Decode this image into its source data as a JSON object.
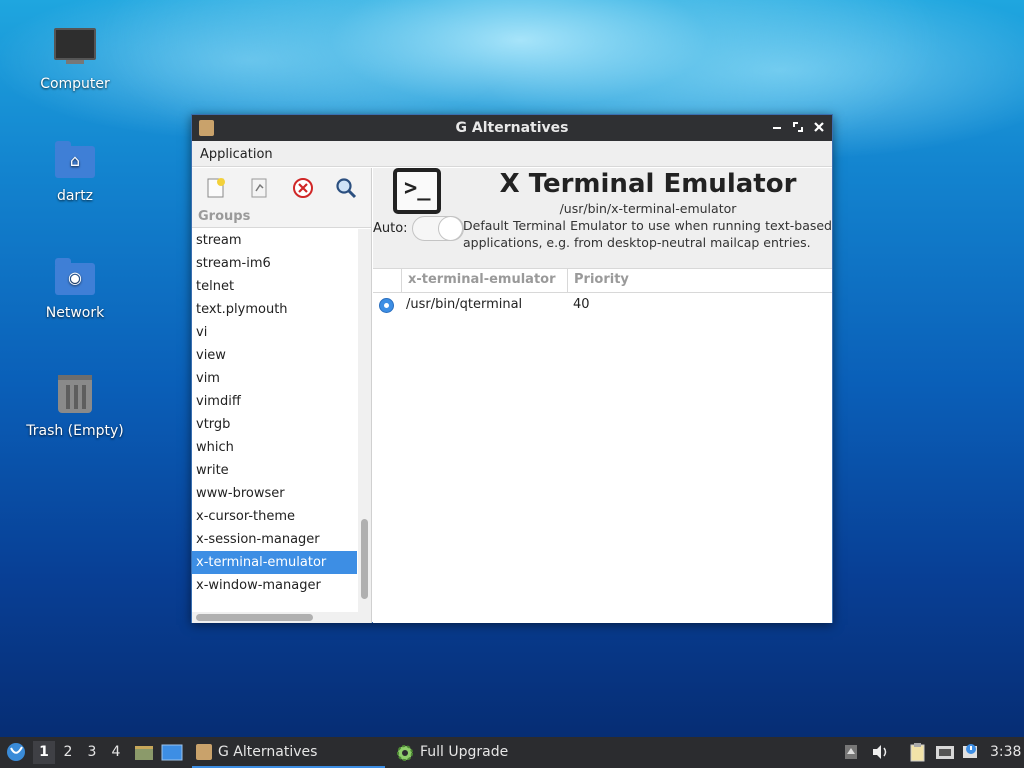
{
  "desktop": {
    "icons": [
      {
        "label": "Computer"
      },
      {
        "label": "dartz"
      },
      {
        "label": "Network"
      },
      {
        "label": "Trash (Empty)"
      }
    ]
  },
  "window": {
    "title": "G Alternatives",
    "menu": {
      "application": "Application"
    },
    "groups_header": "Groups",
    "groups": [
      "stream",
      "stream-im6",
      "telnet",
      "text.plymouth",
      "vi",
      "view",
      "vim",
      "vimdiff",
      "vtrgb",
      "which",
      "write",
      "www-browser",
      "x-cursor-theme",
      "x-session-manager",
      "x-terminal-emulator",
      "x-window-manager"
    ],
    "selected_group": "x-terminal-emulator",
    "detail": {
      "title": "X Terminal Emulator",
      "path": "/usr/bin/x-terminal-emulator",
      "auto_label": "Auto:",
      "description": "Default Terminal Emulator to use when running text-based applications, e.g. from desktop-neutral mailcap entries.",
      "columns": [
        "x-terminal-emulator",
        "Priority"
      ],
      "rows": [
        {
          "path": "/usr/bin/qterminal",
          "priority": "40",
          "selected": true
        }
      ]
    }
  },
  "taskbar": {
    "workspaces": [
      "1",
      "2",
      "3",
      "4"
    ],
    "active_workspace": "1",
    "tasks": [
      {
        "label": "G Alternatives",
        "active": true
      },
      {
        "label": "Full Upgrade",
        "active": false
      }
    ],
    "clock": "3:38"
  },
  "colors": {
    "accent": "#3d8ee4",
    "titlebar": "#2f3033",
    "taskbar": "#2b2c2f"
  }
}
